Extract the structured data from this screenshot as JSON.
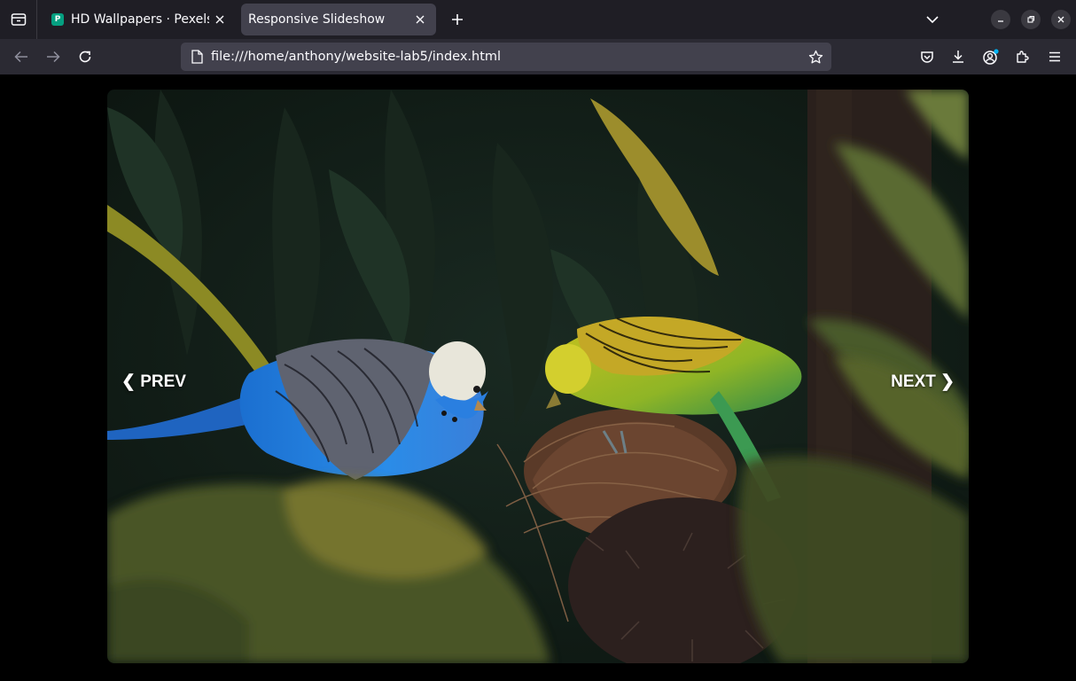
{
  "browser": {
    "tabs": [
      {
        "title": "HD Wallpapers · Pexels",
        "favicon": "P",
        "active": false
      },
      {
        "title": "Responsive Slideshow",
        "active": true
      }
    ],
    "url": "file:///home/anthony/website-lab5/index.html"
  },
  "icons": {
    "tab_list": "tab-list-icon",
    "close": "close-icon",
    "new_tab": "plus-icon",
    "overflow": "chevron-down-icon",
    "back": "arrow-left-icon",
    "forward": "arrow-right-icon",
    "reload": "reload-icon",
    "page": "page-icon",
    "bookmark": "star-icon",
    "pocket": "pocket-icon",
    "downloads": "download-icon",
    "account": "account-icon",
    "extensions": "puzzle-icon",
    "menu": "hamburger-icon"
  },
  "slideshow": {
    "prev_label": "❮ PREV",
    "next_label": "NEXT ❯"
  },
  "colors": {
    "tab_strip": "#1f1e25",
    "nav_bar": "#2b2a33",
    "active_tab": "#42414d",
    "page_bg": "#000000",
    "favicon": "#05a081"
  }
}
